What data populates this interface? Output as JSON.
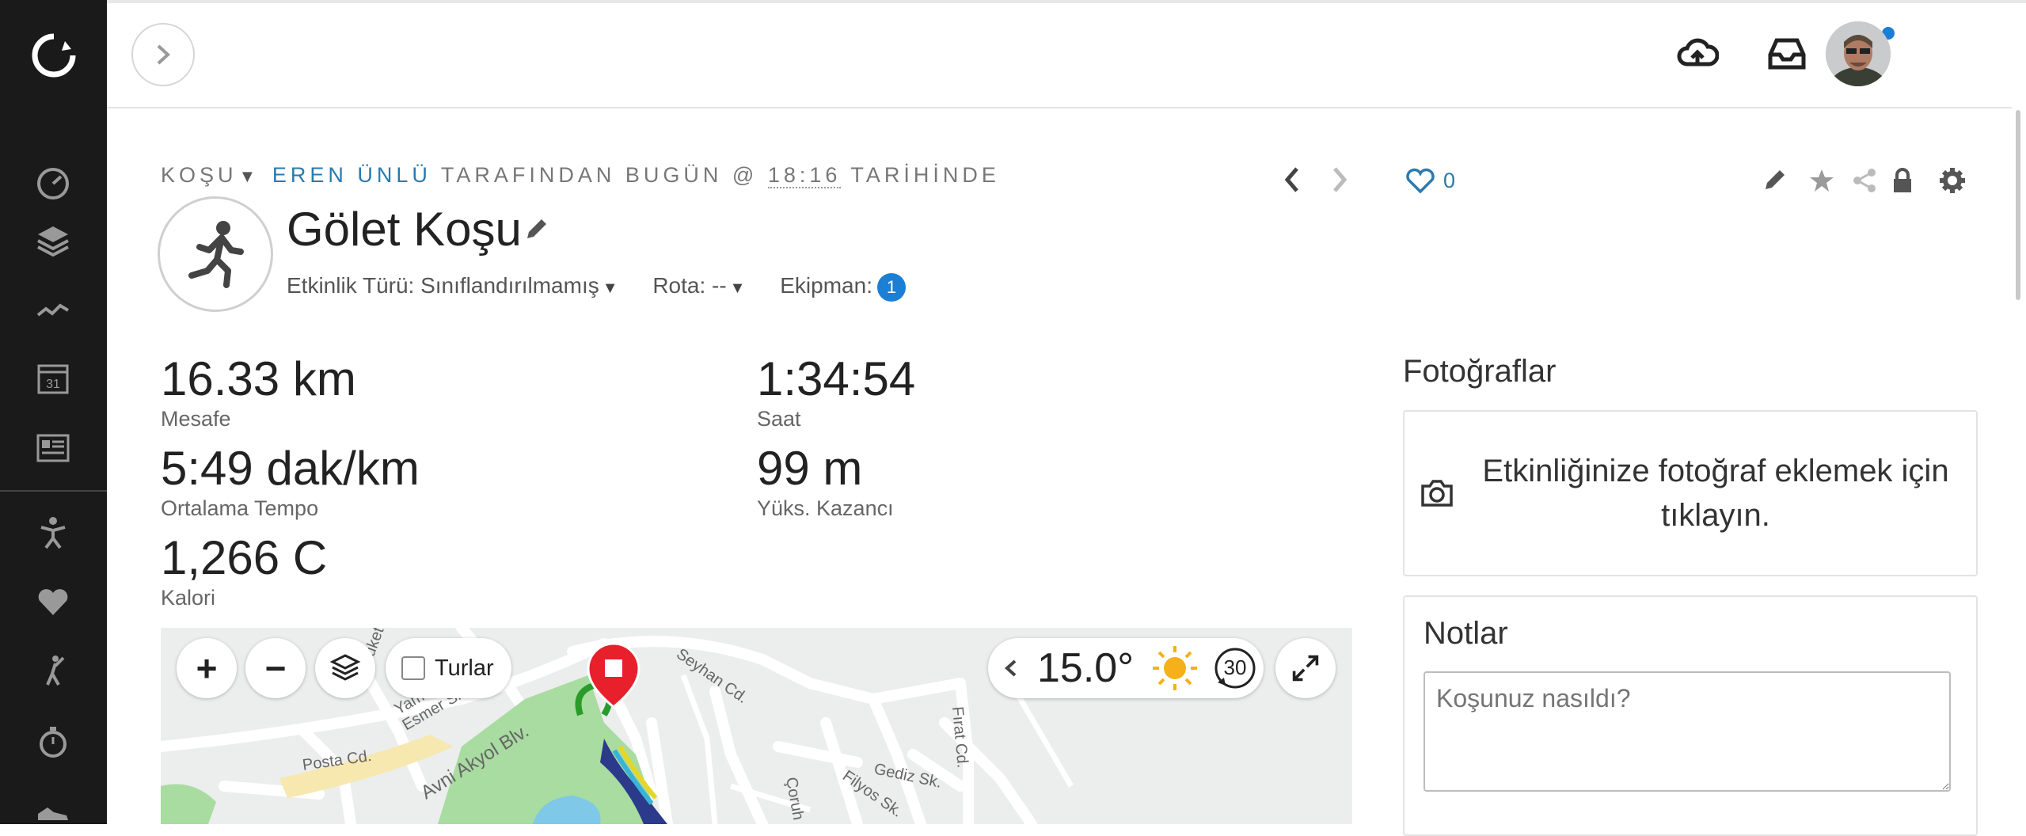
{
  "header": {
    "activity_type": "KOŞU",
    "author": "EREN ÜNLÜ",
    "by_today": "TARAFINDAN BUGÜN @",
    "time": "18:16",
    "suffix": "TARİHİNDE"
  },
  "activity": {
    "title": "Gölet Koşu",
    "type_label": "Etkinlik Türü: Sınıflandırılmamış",
    "route_label": "Rota: --",
    "equipment_label": "Ekipman:",
    "equipment_count": "1",
    "likes": "0"
  },
  "stats": {
    "distance": {
      "value": "16.33 km",
      "label": "Mesafe"
    },
    "time": {
      "value": "1:34:54",
      "label": "Saat"
    },
    "pace": {
      "value": "5:49 dak/km",
      "label": "Ortalama Tempo"
    },
    "elevation": {
      "value": "99 m",
      "label": "Yüks. Kazancı"
    },
    "calories": {
      "value": "1,266 C",
      "label": "Kalori"
    }
  },
  "photos": {
    "title": "Fotoğraflar",
    "prompt": "Etkinliğinize fotoğraf eklemek için tıklayın."
  },
  "notes": {
    "title": "Notlar",
    "placeholder": "Koşunuz nasıldı?"
  },
  "map": {
    "zoom_in": "+",
    "zoom_out": "−",
    "laps_label": "Turlar",
    "temperature": "15.0°",
    "wind_speed": "30",
    "streets": [
      "Seyhan Cd.",
      "Yamaç Çk.",
      "Esmer Sk.",
      "Posta Cd.",
      "Avni Akyol Blv.",
      "Gediz Sk.",
      "Fırat Cd.",
      "Filyos Sk.",
      "Çoruh",
      "duket"
    ]
  },
  "colors": {
    "sidebar": "#1a1a1a",
    "accent": "#1a7fd5",
    "link": "#2a7ab0",
    "stop_marker": "#e8202b",
    "park": "#a8dca0"
  }
}
